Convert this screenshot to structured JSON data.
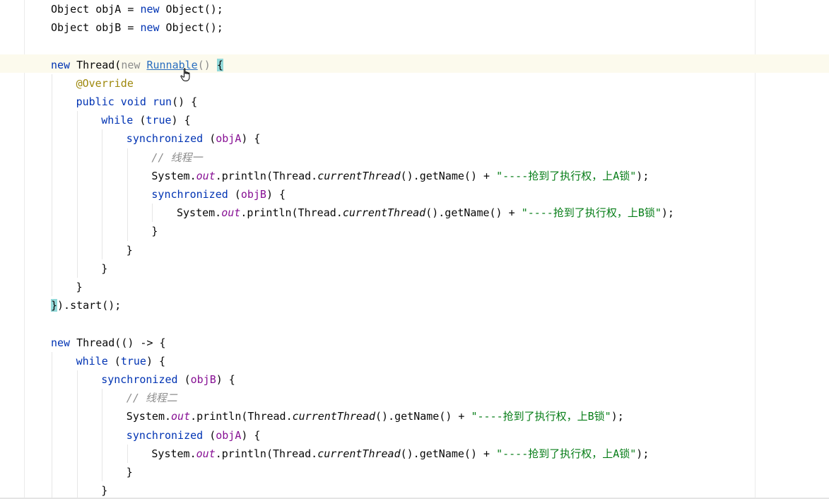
{
  "editor": {
    "language": "java",
    "theme": "light",
    "colors": {
      "keyword": "#0033b3",
      "string": "#067d17",
      "field": "#871094",
      "comment": "#8c8c8c",
      "annotation": "#9e880d",
      "link": "#2a6ebf",
      "brace_match": "#93d9d9",
      "current_line": "#fcfaed"
    },
    "lines": [
      {
        "indent": 0,
        "tokens": [
          [
            "plain",
            "Object objA = "
          ],
          [
            "keyword",
            "new"
          ],
          [
            "plain",
            " Object();"
          ]
        ]
      },
      {
        "indent": 0,
        "tokens": [
          [
            "plain",
            "Object objB = "
          ],
          [
            "keyword",
            "new"
          ],
          [
            "plain",
            " Object();"
          ]
        ]
      },
      {
        "indent": 0,
        "tokens": []
      },
      {
        "indent": 0,
        "current": true,
        "tokens": [
          [
            "keyword",
            "new"
          ],
          [
            "plain",
            " Thread("
          ],
          [
            "muted",
            "new "
          ],
          [
            "link",
            "Runnable"
          ],
          [
            "muted",
            "() "
          ],
          [
            "bracematch",
            "{"
          ]
        ]
      },
      {
        "indent": 1,
        "tokens": [
          [
            "annotation",
            "@Override"
          ]
        ]
      },
      {
        "indent": 1,
        "tokens": [
          [
            "keyword",
            "public void"
          ],
          [
            "plain",
            " "
          ],
          [
            "keyword",
            "run"
          ],
          [
            "plain",
            "() {"
          ]
        ]
      },
      {
        "indent": 2,
        "tokens": [
          [
            "keyword",
            "while"
          ],
          [
            "plain",
            " ("
          ],
          [
            "keyword",
            "true"
          ],
          [
            "plain",
            ") {"
          ]
        ]
      },
      {
        "indent": 3,
        "tokens": [
          [
            "keyword",
            "synchronized"
          ],
          [
            "plain",
            " ("
          ],
          [
            "field",
            "objA"
          ],
          [
            "plain",
            ") {"
          ]
        ]
      },
      {
        "indent": 4,
        "tokens": [
          [
            "comment",
            "// 线程一"
          ]
        ]
      },
      {
        "indent": 4,
        "tokens": [
          [
            "plain",
            "System."
          ],
          [
            "static",
            "out"
          ],
          [
            "plain",
            ".println(Thread."
          ],
          [
            "static-method",
            "currentThread"
          ],
          [
            "plain",
            "().getName() + "
          ],
          [
            "string",
            "\"----抢到了执行权，上A锁\""
          ],
          [
            "plain",
            ");"
          ]
        ]
      },
      {
        "indent": 4,
        "tokens": [
          [
            "keyword",
            "synchronized"
          ],
          [
            "plain",
            " ("
          ],
          [
            "field",
            "objB"
          ],
          [
            "plain",
            ") {"
          ]
        ]
      },
      {
        "indent": 5,
        "tokens": [
          [
            "plain",
            "System."
          ],
          [
            "static",
            "out"
          ],
          [
            "plain",
            ".println(Thread."
          ],
          [
            "static-method",
            "currentThread"
          ],
          [
            "plain",
            "().getName() + "
          ],
          [
            "string",
            "\"----抢到了执行权，上B锁\""
          ],
          [
            "plain",
            ");"
          ]
        ]
      },
      {
        "indent": 4,
        "tokens": [
          [
            "plain",
            "}"
          ]
        ]
      },
      {
        "indent": 3,
        "tokens": [
          [
            "plain",
            "}"
          ]
        ]
      },
      {
        "indent": 2,
        "tokens": [
          [
            "plain",
            "}"
          ]
        ]
      },
      {
        "indent": 1,
        "tokens": [
          [
            "plain",
            "}"
          ]
        ]
      },
      {
        "indent": 0,
        "tokens": [
          [
            "bracematch",
            "}"
          ],
          [
            "plain",
            ").start();"
          ]
        ]
      },
      {
        "indent": 0,
        "tokens": []
      },
      {
        "indent": 0,
        "tokens": [
          [
            "keyword",
            "new"
          ],
          [
            "plain",
            " Thread(() -> {"
          ]
        ]
      },
      {
        "indent": 1,
        "tokens": [
          [
            "keyword",
            "while"
          ],
          [
            "plain",
            " ("
          ],
          [
            "keyword",
            "true"
          ],
          [
            "plain",
            ") {"
          ]
        ]
      },
      {
        "indent": 2,
        "tokens": [
          [
            "keyword",
            "synchronized"
          ],
          [
            "plain",
            " ("
          ],
          [
            "field",
            "objB"
          ],
          [
            "plain",
            ") {"
          ]
        ]
      },
      {
        "indent": 3,
        "tokens": [
          [
            "comment",
            "// 线程二"
          ]
        ]
      },
      {
        "indent": 3,
        "tokens": [
          [
            "plain",
            "System."
          ],
          [
            "static",
            "out"
          ],
          [
            "plain",
            ".println(Thread."
          ],
          [
            "static-method",
            "currentThread"
          ],
          [
            "plain",
            "().getName() + "
          ],
          [
            "string",
            "\"----抢到了执行权，上B锁\""
          ],
          [
            "plain",
            ");"
          ]
        ]
      },
      {
        "indent": 3,
        "tokens": [
          [
            "keyword",
            "synchronized"
          ],
          [
            "plain",
            " ("
          ],
          [
            "field",
            "objA"
          ],
          [
            "plain",
            ") {"
          ]
        ]
      },
      {
        "indent": 4,
        "tokens": [
          [
            "plain",
            "System."
          ],
          [
            "static",
            "out"
          ],
          [
            "plain",
            ".println(Thread."
          ],
          [
            "static-method",
            "currentThread"
          ],
          [
            "plain",
            "().getName() + "
          ],
          [
            "string",
            "\"----抢到了执行权，上A锁\""
          ],
          [
            "plain",
            ");"
          ]
        ]
      },
      {
        "indent": 3,
        "tokens": [
          [
            "plain",
            "}"
          ]
        ]
      },
      {
        "indent": 2,
        "tokens": [
          [
            "plain",
            "}"
          ]
        ]
      }
    ]
  },
  "cursor": {
    "icon": "hand-pointer-icon"
  }
}
